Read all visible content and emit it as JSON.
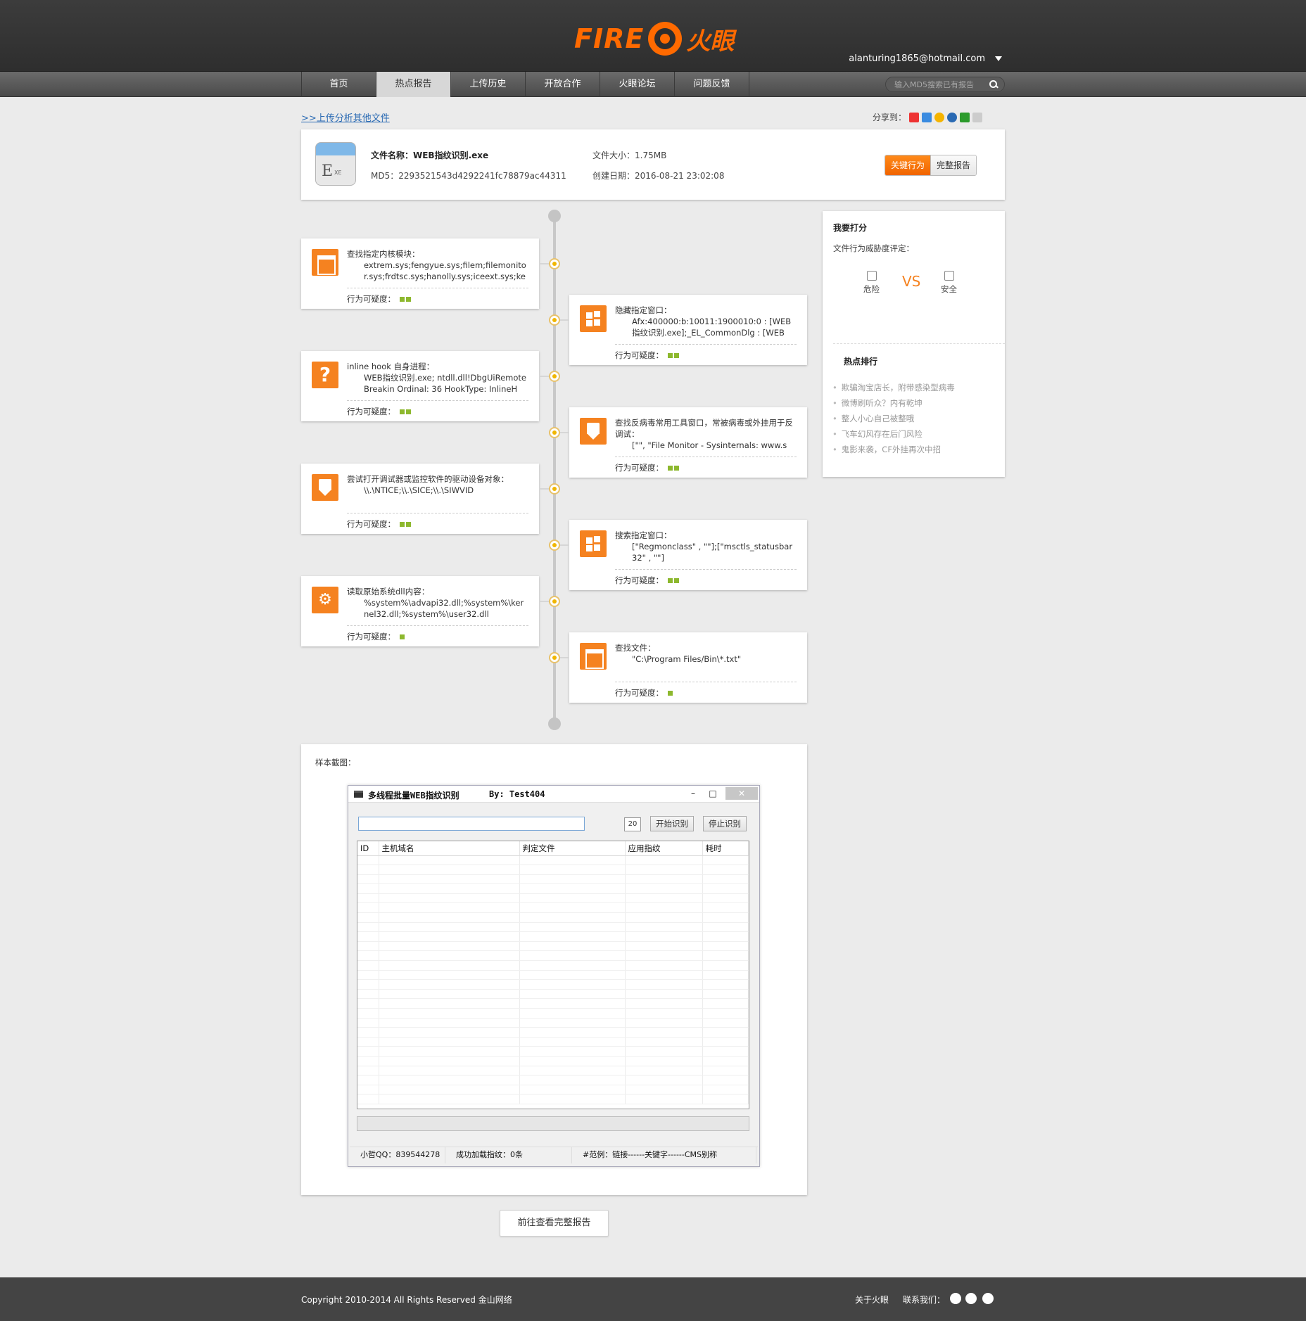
{
  "header": {
    "logo_fire": "FIRE",
    "logo_cn": "火眼",
    "user_email": "alanturing1865@hotmail.com"
  },
  "nav": {
    "tabs": [
      "首页",
      "热点报告",
      "上传历史",
      "开放合作",
      "火眼论坛",
      "问题反馈"
    ],
    "active_index": 1,
    "search_placeholder": "输入MD5搜索已有报告"
  },
  "toolbar": {
    "upload_link": ">>上传分析其他文件",
    "share_label": "分享到："
  },
  "file": {
    "icon_letter": "E",
    "icon_sub": "XE",
    "name_label": "文件名称：WEB指纹识别.exe",
    "md5_label": "MD5：2293521543d4292241fc78879ac44311",
    "size_label": "文件大小：1.75MB",
    "date_label": "创建日期：2016-08-21 23:02:08",
    "btn_key": "关键行为",
    "btn_full": "完整报告"
  },
  "suspicion_label": "行为可疑度：",
  "behaviors": [
    {
      "side": "left",
      "icon": "window-icon",
      "title": "查找指定内核模块：",
      "detail": "extrem.sys;fengyue.sys;filem;filemonitor.sys;frdtsc.sys;hanolly.sys;iceext.sys;ker",
      "level": 2
    },
    {
      "side": "right",
      "icon": "windows-logo-icon",
      "title": "隐藏指定窗口：",
      "detail": "Afx:400000:b:10011:1900010:0 : [WEB指纹识别.exe];_EL_CommonDlg : [WEB",
      "level": 2
    },
    {
      "side": "left",
      "icon": "question-icon",
      "title": "inline hook 自身进程：",
      "detail": "WEB指纹识别.exe; ntdll.dll!DbgUiRemoteBreakin Ordinal: 36 HookType: InlineH",
      "level": 2
    },
    {
      "side": "right",
      "icon": "shield-icon",
      "title": "查找反病毒常用工具窗口，常被病毒或外挂用于反调试：",
      "detail": "[\"\", \"File Monitor - Sysinternals: www.s",
      "level": 2
    },
    {
      "side": "left",
      "icon": "shield-icon",
      "title": "尝试打开调试器或监控软件的驱动设备对象：",
      "detail": "\\\\.\\NTICE;\\\\.\\SICE;\\\\.\\SIWVID",
      "level": 2
    },
    {
      "side": "right",
      "icon": "windows-logo-icon",
      "title": "搜索指定窗口：",
      "detail": "[\"Regmonclass\" , \"\"];[\"msctls_statusbar32\" , \"\"]",
      "level": 2
    },
    {
      "side": "left",
      "icon": "gear-icon",
      "title": "读取原始系统dll内容：",
      "detail": "%system%\\advapi32.dll;%system%\\kernel32.dll;%system%\\user32.dll",
      "level": 1
    },
    {
      "side": "right",
      "icon": "window-icon",
      "title": "查找文件：",
      "detail": "\"C:\\Program Files/Bin\\*.txt\"",
      "level": 1
    }
  ],
  "rating": {
    "title": "我要打分",
    "subtitle": "文件行为威胁度评定：",
    "danger": "危险",
    "vs": "VS",
    "safe": "安全",
    "hot_title": "热点排行",
    "hot_items": [
      "欺骗淘宝店长，附带感染型病毒",
      "微博刷听众？内有乾坤",
      "整人小心自己被整哦",
      "飞车幻风存在后门风险",
      "鬼影来袭，CF外挂再次中招"
    ]
  },
  "sample": {
    "label": "样本截图：",
    "app_title": "多线程批量WEB指纹识别",
    "app_by": "By: Test404",
    "btn_min": "–",
    "btn_max": "□",
    "btn_close": "✕",
    "thread_count": "20",
    "btn_start": "开始识别",
    "btn_stop": "停止识别",
    "columns": [
      "ID",
      "主机域名",
      "判定文件",
      "应用指纹",
      "耗时"
    ],
    "status": [
      "小哲QQ：839544278",
      "成功加载指纹：0条",
      "#范例：链接------关键字------CMS别称"
    ]
  },
  "full_report_button": "前往查看完整报告",
  "footer": {
    "copyright": "Copyright 2010-2014 All Rights Reserved 金山网络",
    "about": "关于火眼",
    "contact": "联系我们："
  },
  "colors": {
    "accent": "#f58220",
    "header_bg": "#333333",
    "link": "#2a6ab3",
    "suspicion_bar": "#8db82e"
  }
}
